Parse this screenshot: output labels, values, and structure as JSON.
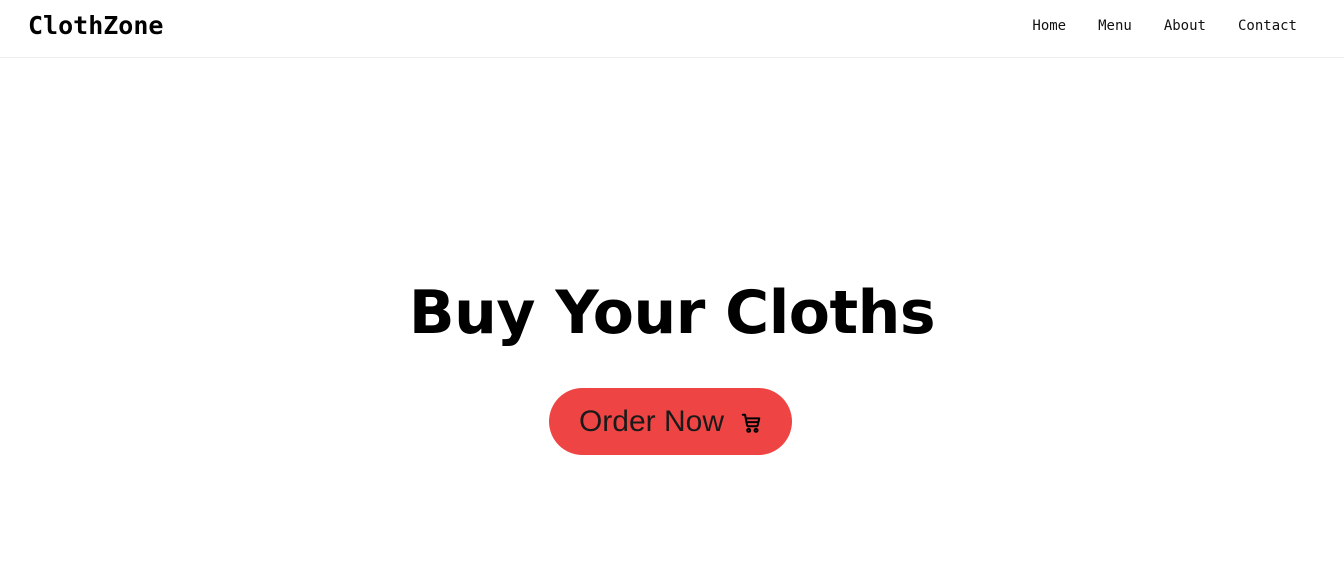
{
  "header": {
    "brand": "ClothZone",
    "nav": [
      {
        "label": "Home"
      },
      {
        "label": "Menu"
      },
      {
        "label": "About"
      },
      {
        "label": "Contact"
      }
    ]
  },
  "hero": {
    "title": "Buy Your Cloths",
    "button": {
      "label": "Order Now",
      "icon": "cart-icon",
      "color": "#ef4444"
    }
  }
}
